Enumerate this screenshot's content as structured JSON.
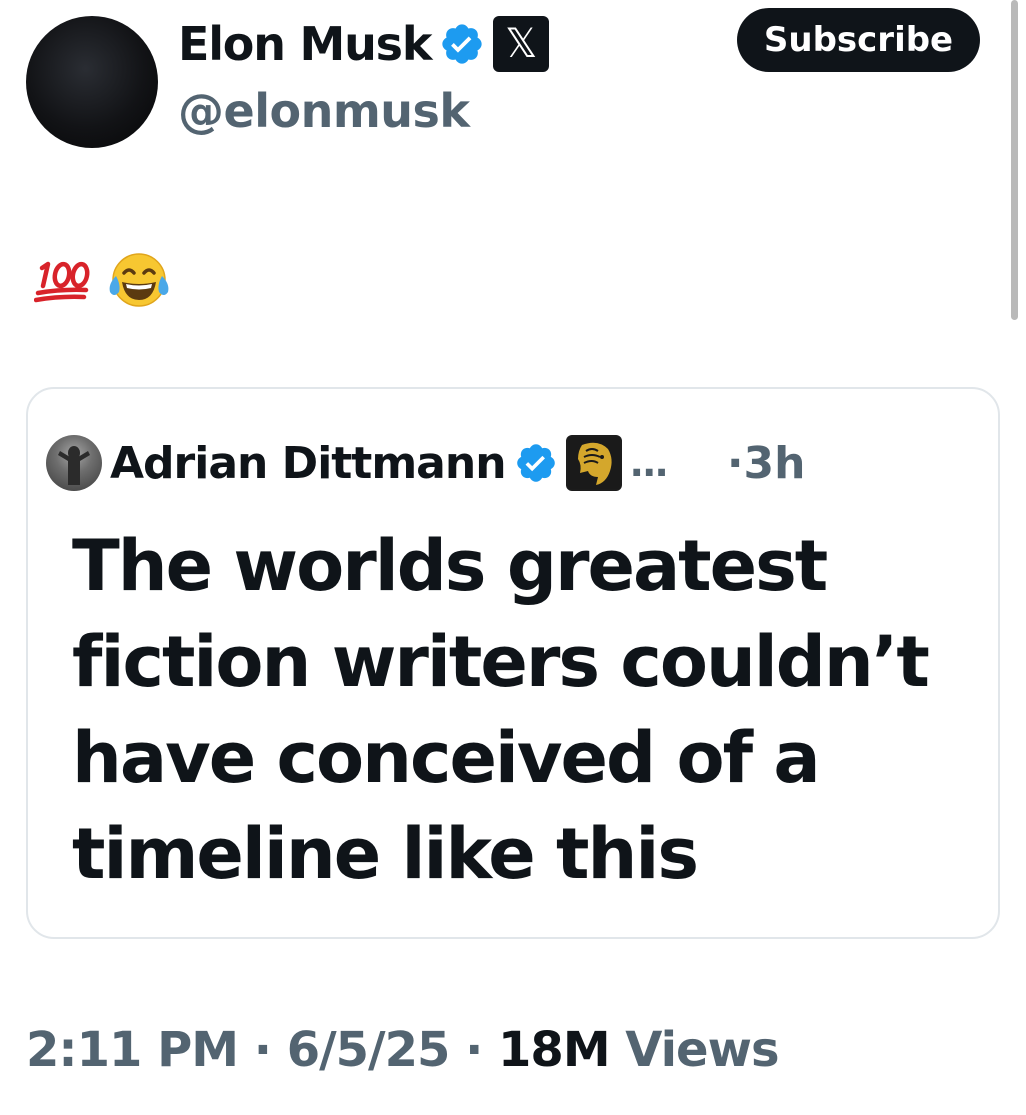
{
  "author": {
    "display_name": "Elon Musk",
    "handle": "@elonmusk",
    "verified_icon": "verified-badge-icon",
    "affiliate_icon": "x-logo-icon",
    "affiliate_glyph": "𝕏"
  },
  "subscribe_label": "Subscribe",
  "post": {
    "emojis": [
      "hundred-points-emoji",
      "tears-of-joy-emoji"
    ]
  },
  "quoted_post": {
    "author_name": "Adrian Dittmann",
    "verified_icon": "verified-badge-icon",
    "affiliate_icon": "golden-lion-icon",
    "truncation": "...",
    "time": "·3h",
    "text": "The worlds greatest fiction writers couldn’t have conceived of a timeline like this"
  },
  "meta": {
    "time": "2:11 PM",
    "date": "6/5/25",
    "views_count": "18M",
    "views_label": "Views",
    "separator": " · "
  },
  "colors": {
    "text_primary": "#0f1419",
    "text_secondary": "#536471",
    "verified_blue": "#1d9bf0",
    "border": "#e1e6ea",
    "emoji_red": "#d8232a",
    "emoji_yellow": "#f7c731"
  }
}
